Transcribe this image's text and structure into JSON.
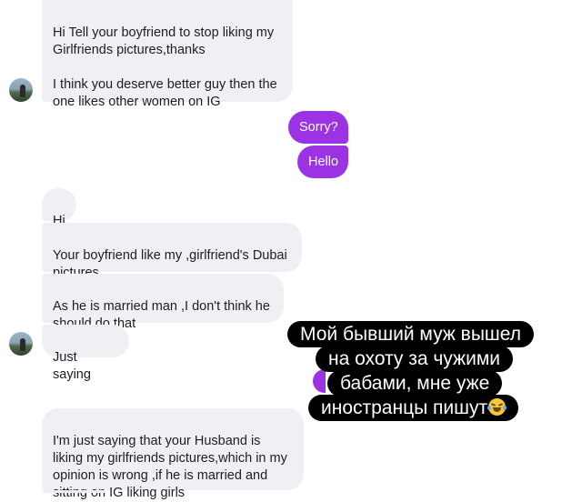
{
  "messages": [
    {
      "sender": "them",
      "text": "Hi Tell your boyfriend to stop liking my Girlfriends pictures,thanks\n\nI think you deserve better guy then the one likes other women on IG"
    },
    {
      "sender": "me",
      "text": "Sorry?"
    },
    {
      "sender": "me",
      "text": "Hello"
    },
    {
      "sender": "them",
      "text": "Hi"
    },
    {
      "sender": "them",
      "text": "Your boyfriend like my ,girlfriend's Dubai pictures"
    },
    {
      "sender": "them",
      "text": "As he is married man ,I don't think he should do that"
    },
    {
      "sender": "them",
      "text": "Just saying"
    },
    {
      "sender": "them",
      "text": "I'm just saying that your Husband is liking my girlfriends pictures,which in my opinion is wrong ,if he is married and sitting on IG liking girls"
    }
  ],
  "overlay_caption": {
    "lines": [
      "Мой бывший муж вышел",
      "на охоту за чужими",
      "бабами, мне уже",
      "иностранцы пишут"
    ],
    "emoji": "face-with-tears-of-joy-icon"
  },
  "colors": {
    "incoming_bubble": "#eff0f3",
    "outgoing_bubble": "#9b32e3",
    "caption_background": "#000000"
  }
}
